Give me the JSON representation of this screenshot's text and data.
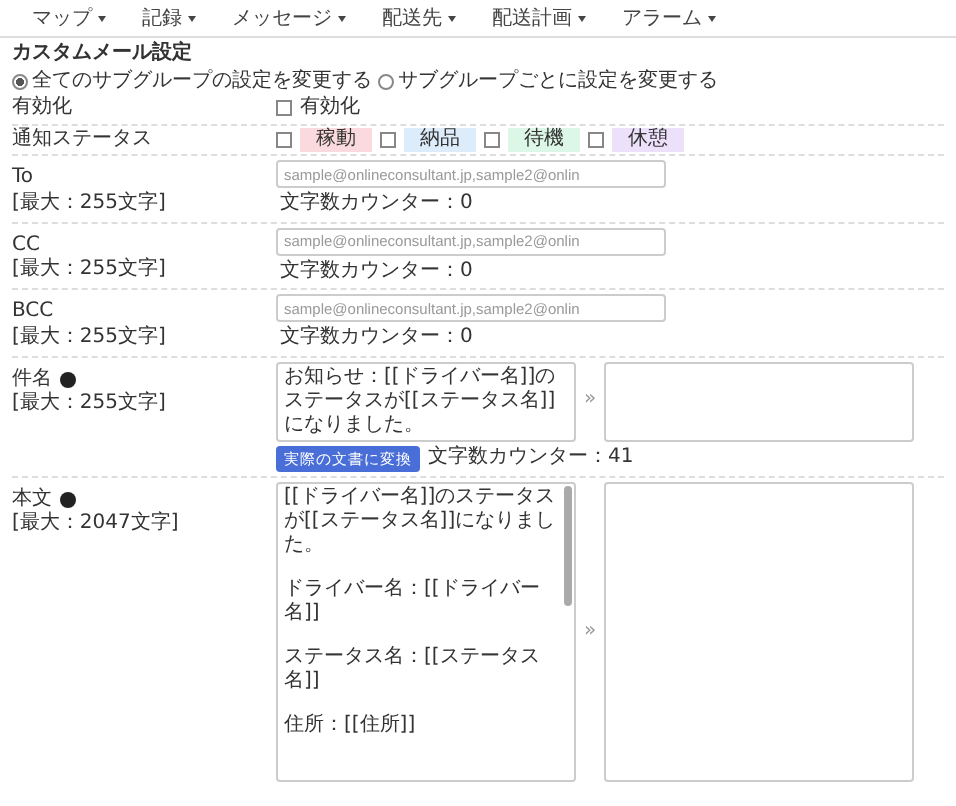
{
  "nav": [
    {
      "label": "マップ"
    },
    {
      "label": "記録"
    },
    {
      "label": "メッセージ"
    },
    {
      "label": "配送先"
    },
    {
      "label": "配送計画"
    },
    {
      "label": "アラーム"
    }
  ],
  "title": "カスタムメール設定",
  "scope_options": [
    {
      "label": "全てのサブグループの設定を変更する",
      "selected": true
    },
    {
      "label": "サブグループごとに設定を変更する",
      "selected": false
    }
  ],
  "enable_row": {
    "label": "有効化",
    "checkbox": {
      "label": "有効化",
      "checked": false
    }
  },
  "status_row": {
    "label": "通知ステータス",
    "statuses": [
      {
        "label": "稼動",
        "checked": false,
        "color": "#fadadd"
      },
      {
        "label": "納品",
        "checked": false,
        "color": "#dcecfa"
      },
      {
        "label": "待機",
        "checked": false,
        "color": "#dcf7e6"
      },
      {
        "label": "休憩",
        "checked": false,
        "color": "#ece0fa"
      }
    ]
  },
  "address_fields": [
    {
      "label": "To",
      "limit": "[最大：255文字]",
      "placeholder": "sample@onlineconsultant.jp,sample2@onlin",
      "counter": "文字数カウンター：0"
    },
    {
      "label": "CC",
      "limit": "[最大：255文字]",
      "placeholder": "sample@onlineconsultant.jp,sample2@onlin",
      "counter": "文字数カウンター：0"
    },
    {
      "label": "BCC",
      "limit": "[最大：255文字]",
      "placeholder": "sample@onlineconsultant.jp,sample2@onlin",
      "counter": "文字数カウンター：0"
    }
  ],
  "subject": {
    "label": "件名",
    "limit": "[最大：255文字]",
    "value": "お知らせ：[[ドライバー名]]のステータスが[[ステータス名]]になりました。",
    "arrow": "»",
    "convert_button": "実際の文書に変換",
    "counter": "文字数カウンター：41"
  },
  "body": {
    "label": "本文",
    "limit": "[最大：2047文字]",
    "lines": [
      "[[ドライバー名]]のステータスが[[ステータス名]]になりました。",
      "ドライバー名：[[ドライバー名]]",
      "ステータス名：[[ステータス名]]",
      "住所：[[住所]]"
    ],
    "arrow": "»"
  }
}
